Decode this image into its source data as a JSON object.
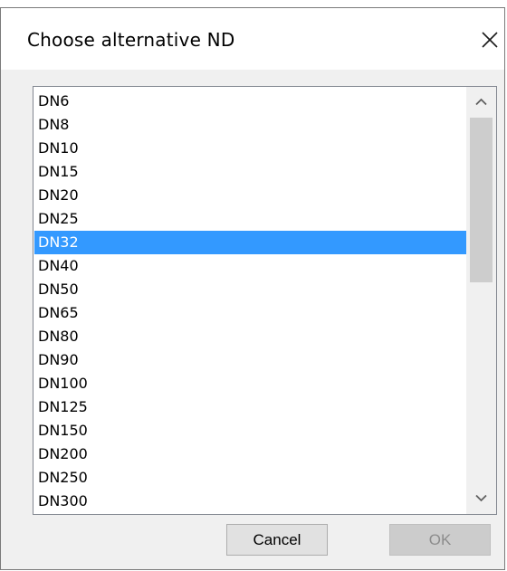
{
  "dialog": {
    "title": "Choose alternative ND",
    "close_icon": "close-icon"
  },
  "list": {
    "items": [
      "DN6",
      "DN8",
      "DN10",
      "DN15",
      "DN20",
      "DN25",
      "DN32",
      "DN40",
      "DN50",
      "DN65",
      "DN80",
      "DN90",
      "DN100",
      "DN125",
      "DN150",
      "DN200",
      "DN250",
      "DN300"
    ],
    "selected_index": 6,
    "selection_color": "#3399ff",
    "scroll_up_icon": "chevron-up-icon",
    "scroll_down_icon": "chevron-down-icon"
  },
  "buttons": {
    "cancel_label": "Cancel",
    "ok_label": "OK",
    "ok_enabled": false
  }
}
